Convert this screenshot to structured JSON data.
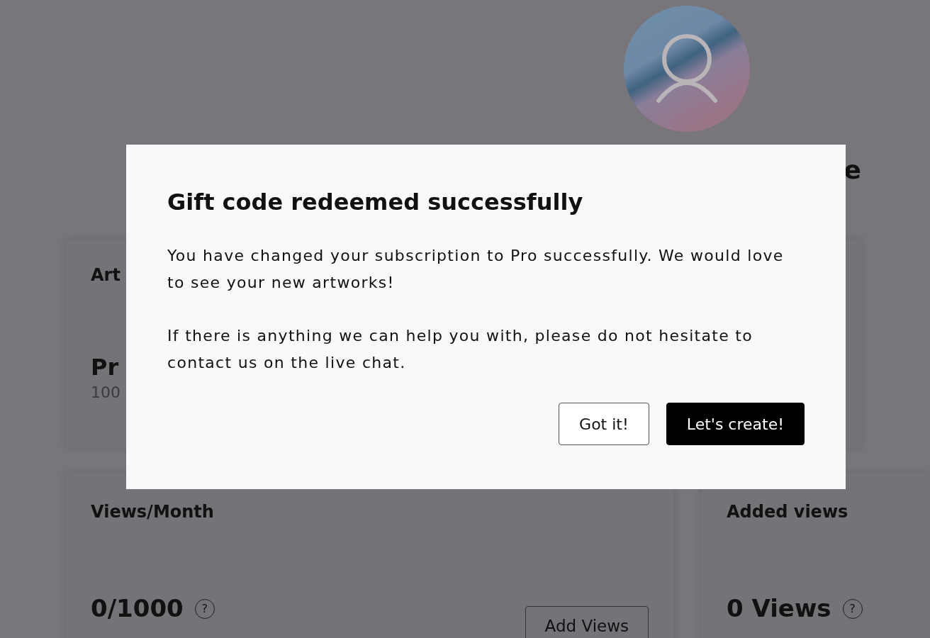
{
  "profile": {
    "name_visible": "e"
  },
  "plan_card": {
    "title": "Art",
    "plan": "Pr",
    "detail": "100"
  },
  "stat_cards": [
    {
      "title": "Views/Month",
      "value": "0/1000",
      "help": "?",
      "button": "Add Views"
    },
    {
      "title": "Added views",
      "value": "0 Views",
      "help": "?"
    }
  ],
  "modal": {
    "title": "Gift code redeemed successfully",
    "paragraphs": [
      "You have changed your subscription to Pro successfully. We would love to see your new artworks!",
      "If there is anything we can help you with, please do not hesitate to contact us on the live chat."
    ],
    "buttons": [
      {
        "label": "Got it!",
        "kind": "outline"
      },
      {
        "label": "Let's create!",
        "kind": "primary"
      }
    ]
  }
}
